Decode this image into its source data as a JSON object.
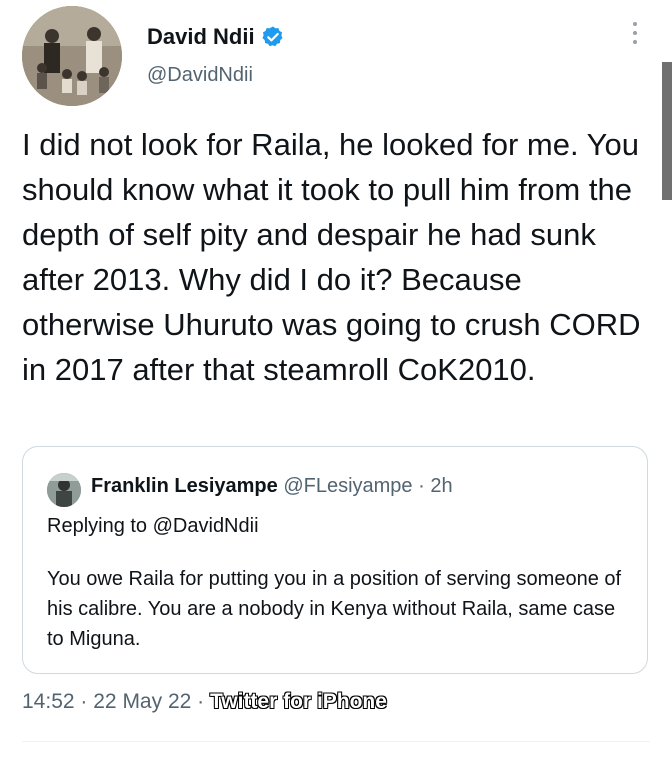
{
  "author": {
    "name": "David Ndii",
    "handle": "@DavidNdii",
    "verified": true
  },
  "tweet": {
    "text": "I did not look for Raila, he looked for me. You should know what it took to pull him from the depth of self pity and despair he had sunk after 2013. Why did I do it? Because otherwise Uhuruto was going to crush CORD in 2017 after that steamroll CoK2010."
  },
  "quoted": {
    "name": "Franklin Lesiyampe",
    "handle": "@FLesiyampe",
    "separator": "·",
    "time": "2h",
    "reply_prefix": "Replying to ",
    "reply_to": "@DavidNdii",
    "text": "You owe Raila for putting you in a position of serving someone of his calibre. You are a nobody in Kenya without Raila, same case to Miguna."
  },
  "meta": {
    "time": "14:52",
    "separator": "·",
    "date": "22 May 22",
    "app": "Twitter for iPhone"
  },
  "colors": {
    "text": "#0f1419",
    "secondary": "#536471",
    "verified": "#1d9bf0",
    "border": "#cfd9de"
  },
  "icons": {
    "verified": "verified-badge-icon",
    "more": "more-vertical-icon"
  }
}
